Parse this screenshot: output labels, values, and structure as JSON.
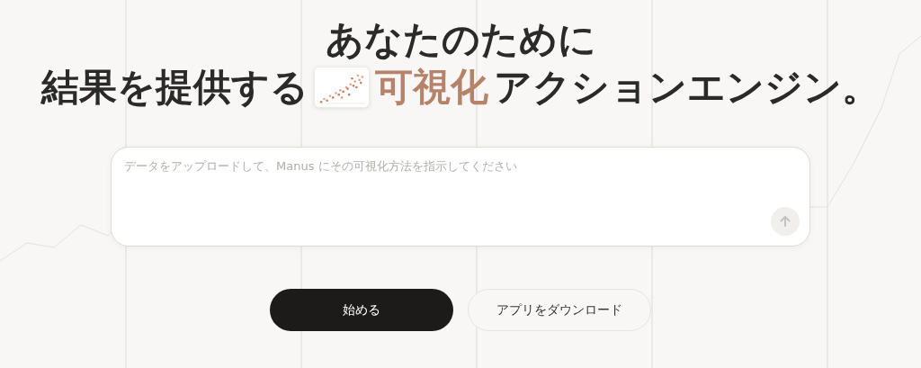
{
  "headline": {
    "line_1": "あなたのために",
    "line_2_start": "結果を提供する",
    "highlight": "可視化",
    "line_2_end": "アクションエンジン。"
  },
  "prompt_box": {
    "placeholder": "データをアップロードして、Manus にその可視化方法を指示してください",
    "send_disabled": true
  },
  "buttons": [
    {
      "label": "始める",
      "kind": "primary"
    },
    {
      "label": "アプリをダウンロード",
      "kind": "secondary"
    }
  ]
}
